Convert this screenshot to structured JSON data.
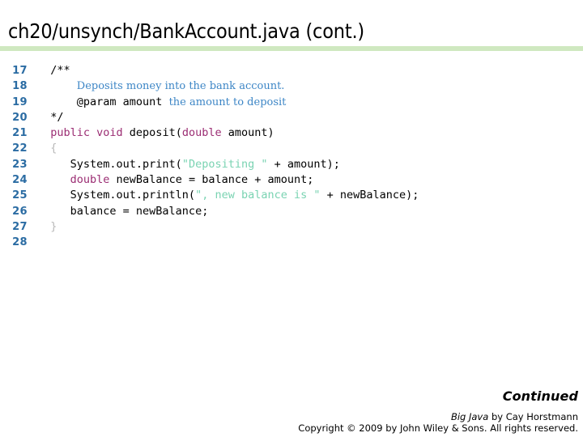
{
  "slide": {
    "title": "ch20/unsynch/BankAccount.java (cont.)",
    "accent_rule_color": "#cfe8c0",
    "lineno_color": "#2b6ca3",
    "keyword_color": "#9b2d73",
    "string_color": "#7ad3b2",
    "doc_color": "#3d86c6"
  },
  "code": {
    "lines": [
      {
        "number": "17",
        "segments": [
          {
            "text": "  /**",
            "style": "plain"
          }
        ]
      },
      {
        "number": "18",
        "segments": [
          {
            "text": "      ",
            "style": "plain"
          },
          {
            "text": "Deposits money into the bank account.",
            "style": "doc"
          }
        ]
      },
      {
        "number": "19",
        "segments": [
          {
            "text": "      @param amount ",
            "style": "plain"
          },
          {
            "text": "the amount to deposit",
            "style": "doc"
          }
        ]
      },
      {
        "number": "20",
        "segments": [
          {
            "text": "  */",
            "style": "plain"
          }
        ]
      },
      {
        "number": "21",
        "segments": [
          {
            "text": "  ",
            "style": "plain"
          },
          {
            "text": "public void",
            "style": "keyword"
          },
          {
            "text": " deposit(",
            "style": "plain"
          },
          {
            "text": "double",
            "style": "keyword"
          },
          {
            "text": " amount)",
            "style": "plain"
          }
        ]
      },
      {
        "number": "22",
        "segments": [
          {
            "text": "  {",
            "style": "faint"
          }
        ]
      },
      {
        "number": "23",
        "segments": [
          {
            "text": "     System.out.print(",
            "style": "plain"
          },
          {
            "text": "\"Depositing \"",
            "style": "string"
          },
          {
            "text": " + amount);",
            "style": "plain"
          }
        ]
      },
      {
        "number": "24",
        "segments": [
          {
            "text": "     ",
            "style": "plain"
          },
          {
            "text": "double",
            "style": "keyword"
          },
          {
            "text": " newBalance = balance + amount;",
            "style": "plain"
          }
        ]
      },
      {
        "number": "25",
        "segments": [
          {
            "text": "     System.out.println(",
            "style": "plain"
          },
          {
            "text": "\", new balance is \"",
            "style": "string"
          },
          {
            "text": " + newBalance);",
            "style": "plain"
          }
        ]
      },
      {
        "number": "26",
        "segments": [
          {
            "text": "     balance = newBalance;",
            "style": "plain"
          }
        ]
      },
      {
        "number": "27",
        "segments": [
          {
            "text": "  }",
            "style": "faint"
          }
        ]
      },
      {
        "number": "28",
        "segments": []
      }
    ]
  },
  "footer": {
    "continued_label": "Continued",
    "credit_book": "Big Java",
    "credit_rest": " by  Cay Horstmann",
    "copyright": "Copyright © 2009 by John Wiley & Sons.  All rights reserved."
  }
}
